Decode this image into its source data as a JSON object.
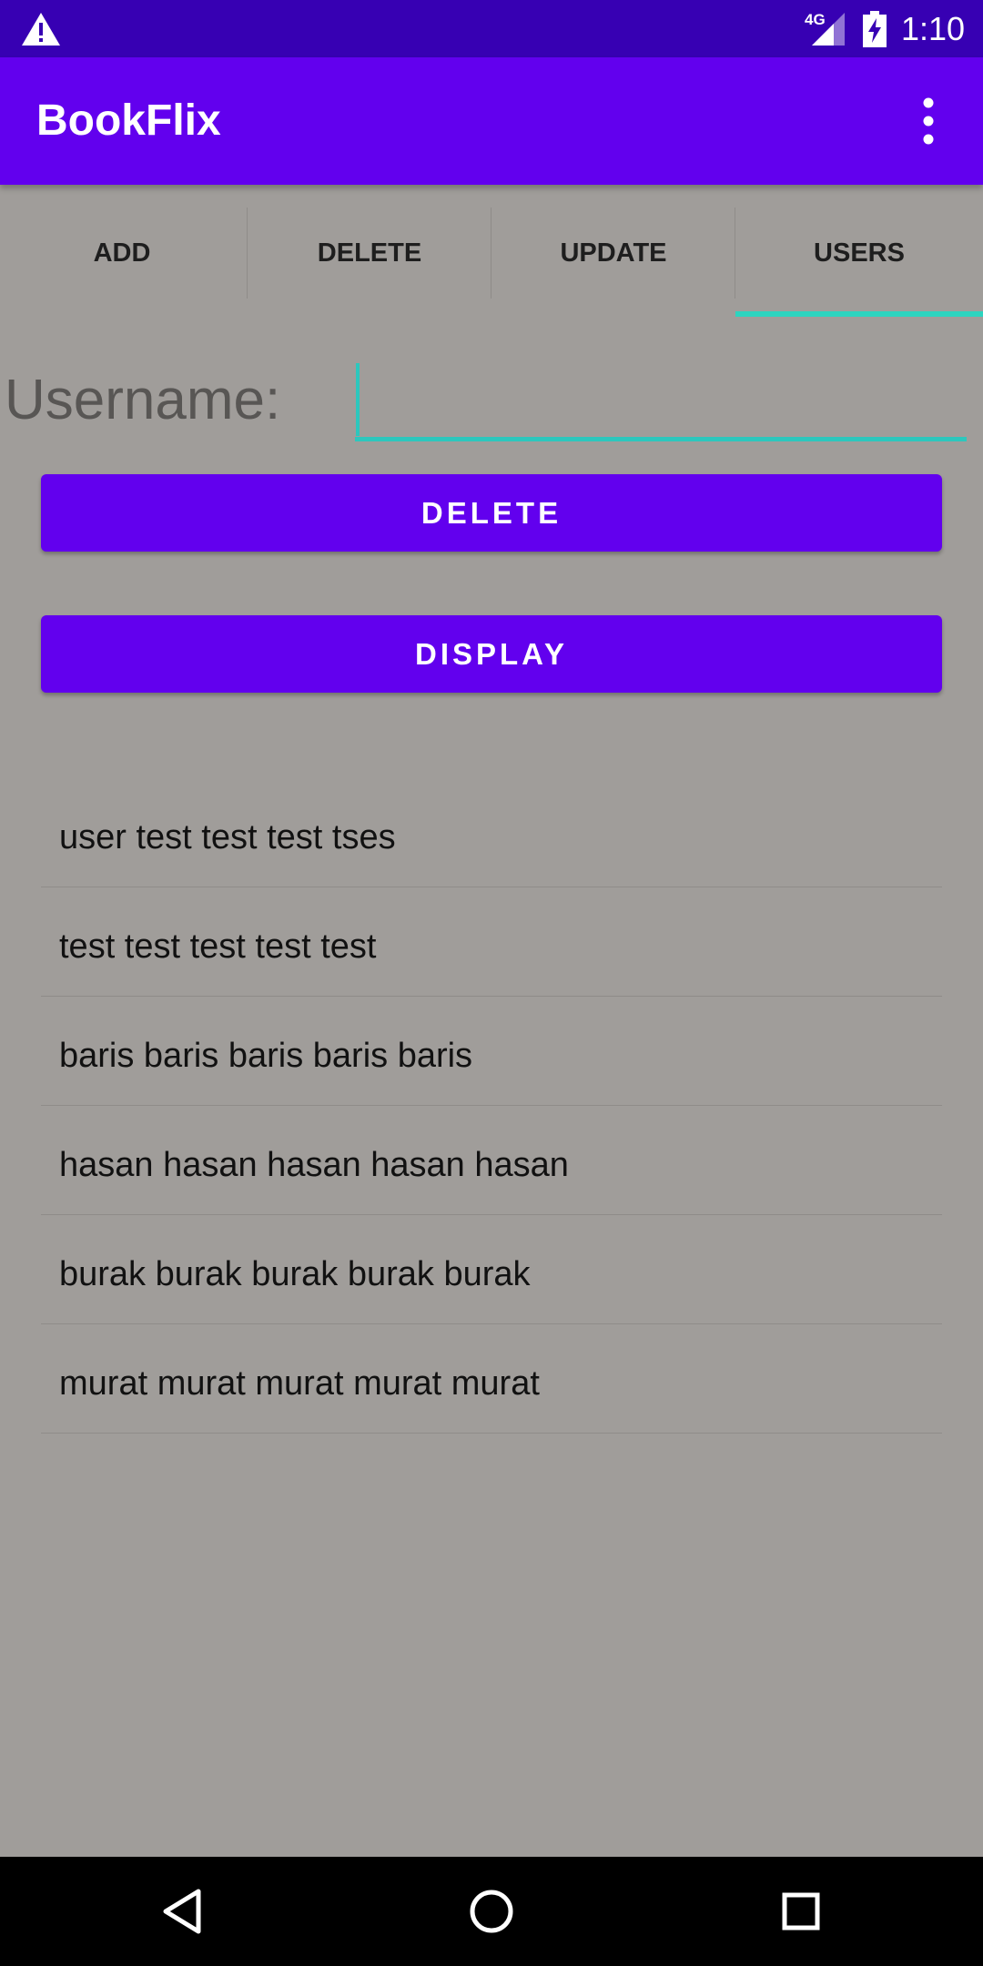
{
  "status_bar": {
    "network": "4G",
    "time": "1:10",
    "icons": [
      "warning-icon",
      "signal-icon",
      "battery-charging-icon"
    ]
  },
  "app_bar": {
    "title": "BookFlix",
    "menu_icon": "more-vert-icon"
  },
  "tabs": [
    {
      "label": "ADD"
    },
    {
      "label": "DELETE"
    },
    {
      "label": "UPDATE"
    },
    {
      "label": "USERS"
    }
  ],
  "active_tab": "USERS",
  "form": {
    "username_label": "Username:",
    "username_value": "",
    "delete_button": "DELETE",
    "display_button": "DISPLAY"
  },
  "users": [
    "user test test test tses",
    "test test test test test",
    "baris baris baris baris baris",
    "hasan hasan hasan hasan hasan",
    "burak burak burak burak burak",
    "murat murat murat murat murat"
  ],
  "nav_bar": {
    "icons": [
      "back-icon",
      "home-icon",
      "recents-icon"
    ]
  },
  "colors": {
    "status_bar": "#3700b3",
    "primary": "#6200ee",
    "accent": "#2dd4bf",
    "background": "#a09d9a"
  }
}
